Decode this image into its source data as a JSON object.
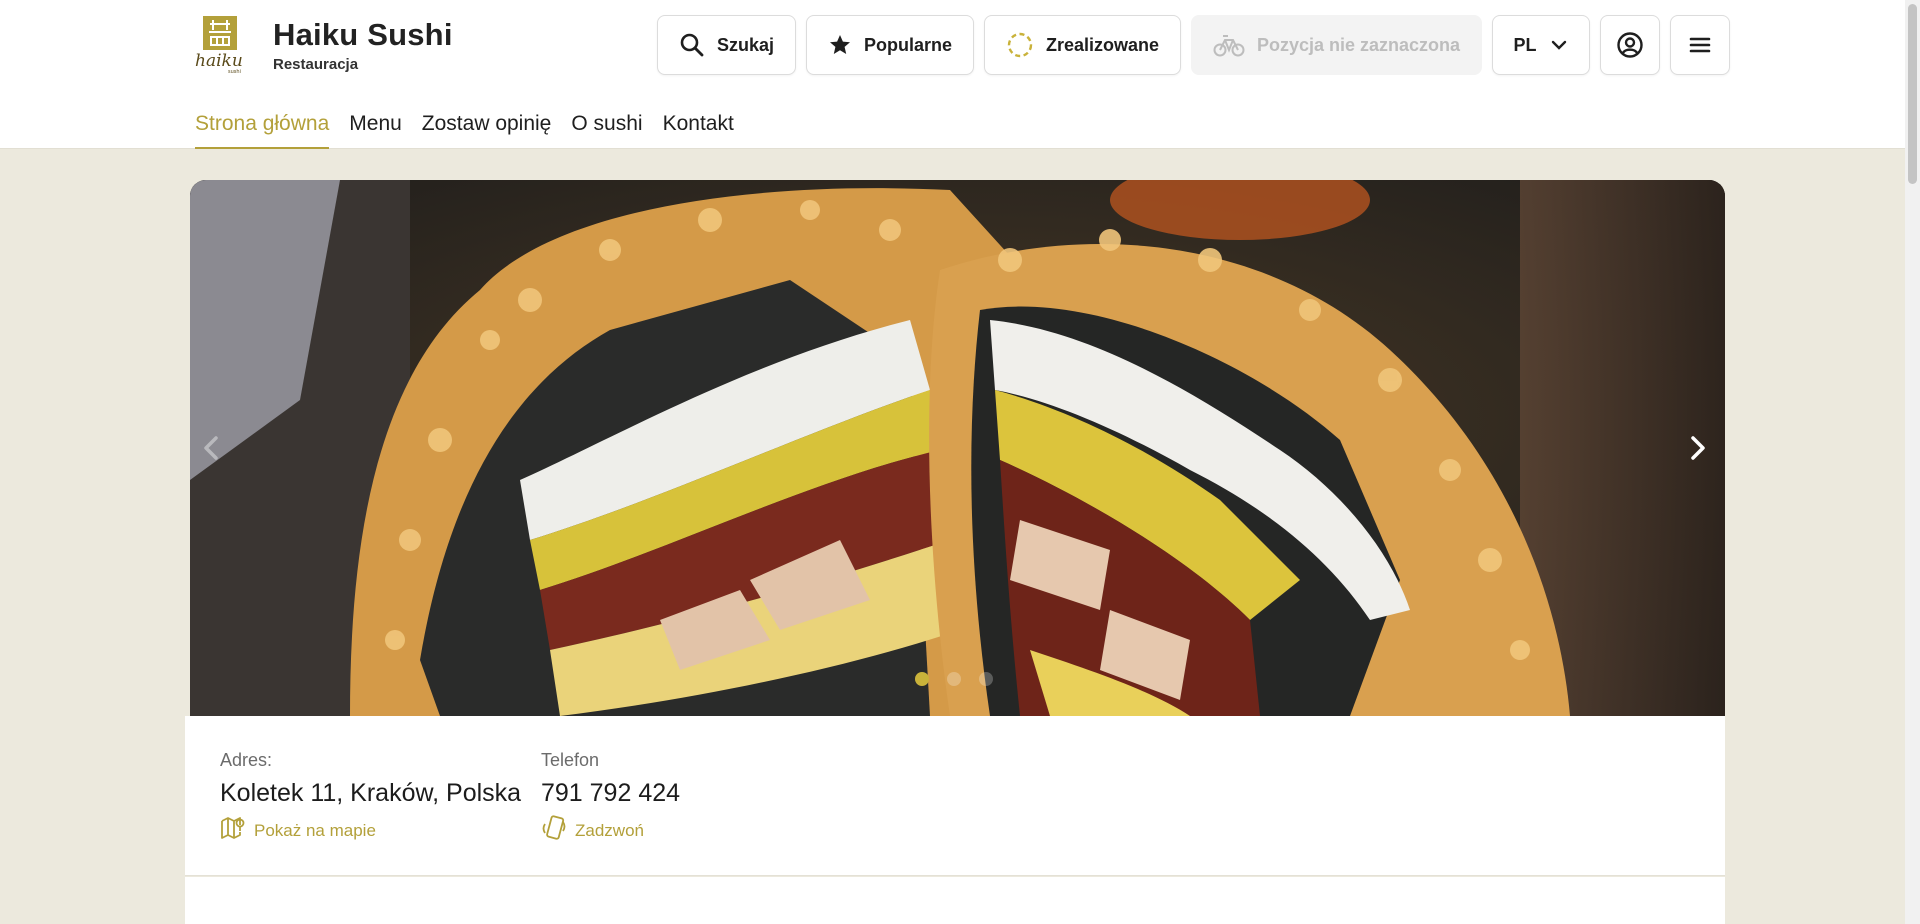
{
  "brand": {
    "name": "Haiku Sushi",
    "subtitle": "Restauracja",
    "logo_text": "haiku",
    "logo_small": "sushi",
    "logo_color": "#b3a03a"
  },
  "toolbar": {
    "search_label": "Szukaj",
    "popular_label": "Popularne",
    "completed_label": "Zrealizowane",
    "position_label": "Pozycja nie zaznaczona",
    "language": "PL"
  },
  "nav": [
    {
      "label": "Strona główna",
      "active": true
    },
    {
      "label": "Menu",
      "active": false
    },
    {
      "label": "Zostaw opinię",
      "active": false
    },
    {
      "label": "O sushi",
      "active": false
    },
    {
      "label": "Kontakt",
      "active": false
    }
  ],
  "carousel": {
    "slide_count": 3,
    "active_index": 0
  },
  "info": {
    "address_label": "Adres:",
    "address_value": "Koletek 11, Kraków, Polska",
    "map_link": "Pokaż na mapie",
    "phone_label": "Telefon",
    "phone_value": "791 792 424",
    "call_link": "Zadzwoń"
  },
  "colors": {
    "accent": "#b3a03a",
    "background": "#ece9dd"
  }
}
